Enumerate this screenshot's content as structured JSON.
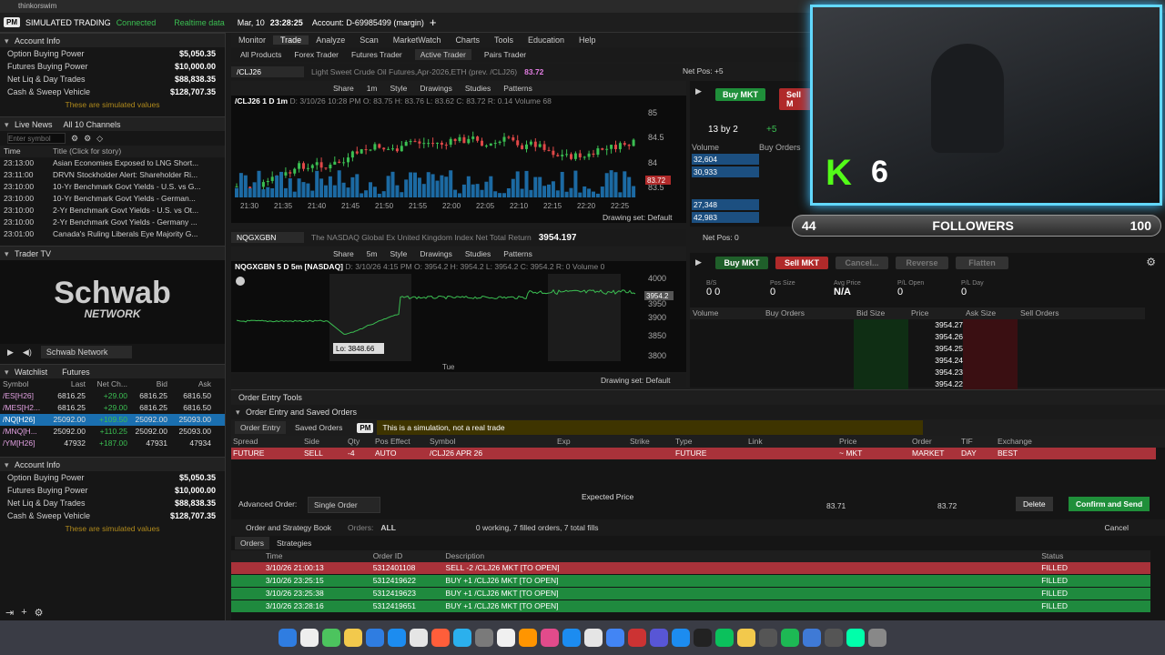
{
  "mac_app": "thinkorswim",
  "header": {
    "pm": "PM",
    "sim": "SIMULATED TRADING",
    "connected": "Connected",
    "realtime": "Realtime data",
    "date": "Mar, 10",
    "time": "23:28:25",
    "account": "Account: D-69985499 (margin)"
  },
  "left": {
    "account_title": "Account Info",
    "account": [
      [
        "Option Buying Power",
        "$5,050.35"
      ],
      [
        "Futures Buying Power",
        "$10,000.00"
      ],
      [
        "Net Liq & Day Trades",
        "$88,838.35"
      ],
      [
        "Cash & Sweep Vehicle",
        "$128,707.35"
      ]
    ],
    "sim_note": "These are simulated values",
    "news_title": "Live News",
    "news_channels": "All 10 Channels",
    "news_search": "Enter symbol",
    "news_cols": [
      "Time",
      "Title (Click for story)"
    ],
    "news": [
      [
        "23:13:00",
        "Asian Economies Exposed to LNG Short..."
      ],
      [
        "23:11:00",
        "DRVN Stockholder Alert: Shareholder Ri..."
      ],
      [
        "23:10:00",
        "10-Yr Benchmark Govt Yields - U.S. vs G..."
      ],
      [
        "23:10:00",
        "10-Yr Benchmark Govt Yields - German..."
      ],
      [
        "23:10:00",
        "2-Yr Benchmark Govt Yields - U.S. vs Ot..."
      ],
      [
        "23:10:00",
        "2-Yr Benchmark Govt Yields - Germany ..."
      ],
      [
        "23:01:00",
        "Canada's Ruling Liberals Eye Majority G..."
      ]
    ],
    "tv_title": "Trader TV",
    "tv_logo": "Schwab",
    "tv_logo_sub": "NETWORK",
    "tv_channel": "Schwab Network",
    "wl_title": "Watchlist",
    "wl_name": "Futures",
    "wl_cols": [
      "Symbol",
      "Last",
      "Net Ch...",
      "Bid",
      "Ask"
    ],
    "wl": [
      [
        "/ES[H26]",
        "6816.25",
        "+29.00",
        "6816.25",
        "6816.50"
      ],
      [
        "/MES[H2...",
        "6816.25",
        "+29.00",
        "6816.25",
        "6816.50"
      ],
      [
        "/NQ[H26]",
        "25092.00",
        "+109.50",
        "25092.00",
        "25093.00"
      ],
      [
        "/MNQ[H...",
        "25092.00",
        "+110.25",
        "25092.00",
        "25093.00"
      ],
      [
        "/YM[H26]",
        "47932",
        "+187.00",
        "47931",
        "47934"
      ]
    ],
    "account2_title": "Account Info"
  },
  "menu": [
    "Monitor",
    "Trade",
    "Analyze",
    "Scan",
    "MarketWatch",
    "Charts",
    "Tools",
    "Education",
    "Help"
  ],
  "submenu": [
    "All Products",
    "Forex Trader",
    "Futures Trader",
    "Active Trader",
    "Pairs Trader"
  ],
  "chart1": {
    "symbol": "/CLJ26",
    "desc": "Light Sweet Crude Oil Futures,Apr-2026,ETH (prev. /CLJ26)",
    "last": "83.72",
    "netpos": "Net Pos: +5",
    "title": "/CLJ26 1 D 1m",
    "ohlc": "D: 3/10/26 10:28 PM  O: 83.75  H: 83.76  L: 83.62  C: 83.72  R: 0.14  Volume 68",
    "tools": [
      "Share",
      "1m",
      "Style",
      "Drawings",
      "Studies",
      "Patterns"
    ],
    "yticks": [
      "85",
      "84.5",
      "84",
      "83.5"
    ],
    "price_tag": "83.72",
    "xticks": [
      "21:30",
      "21:35",
      "21:40",
      "21:45",
      "21:50",
      "21:55",
      "22:00",
      "22:05",
      "22:10",
      "22:15",
      "22:20",
      "22:25"
    ],
    "drawing": "Drawing set: Default",
    "buy": "Buy MKT",
    "sell": "Sell M",
    "bs": "13 by 2",
    "pos": "+5",
    "vol_cols": [
      "Volume",
      "Buy Orders"
    ],
    "vols": [
      "32,604",
      "30,933",
      "27,348",
      "42,983"
    ]
  },
  "chart2": {
    "symbol": "NQGXGBN",
    "desc": "The NASDAQ Global Ex United Kingdom Index Net Total Return",
    "last": "3954.197",
    "netpos": "Net Pos: 0",
    "title": "NQGXGBN 5 D 5m [NASDAQ]",
    "ohlc": "D: 3/10/26 4:15 PM  O: 3954.2  H: 3954.2  L: 3954.2  C: 3954.2  R: 0  Volume 0",
    "tools": [
      "Share",
      "5m",
      "Style",
      "Drawings",
      "Studies",
      "Patterns"
    ],
    "yticks": [
      "4000",
      "3950",
      "3900",
      "3850",
      "3800"
    ],
    "price_tag": "3954.2",
    "lo": "Lo: 3848.66",
    "xlabel": "Tue",
    "drawing": "Drawing set: Default"
  },
  "trade2": {
    "buttons": [
      "Buy MKT",
      "Sell MKT",
      "Cancel...",
      "Reverse",
      "Flatten"
    ],
    "stats_lbl": [
      "B/S",
      "Pos Size",
      "Avg Price",
      "P/L Open",
      "P/L Day"
    ],
    "stats": [
      "0  0",
      "0",
      "N/A",
      "0",
      "0"
    ],
    "cols": [
      "Volume",
      "Buy Orders",
      "Bid Size",
      "Price",
      "Ask Size",
      "Sell Orders"
    ],
    "prices": [
      "3954.27",
      "3954.26",
      "3954.25",
      "3954.24",
      "3954.23",
      "3954.22"
    ]
  },
  "oe": {
    "title": "Order Entry Tools",
    "sub": "Order Entry and Saved Orders",
    "tab1": "Order Entry",
    "tab2": "Saved Orders",
    "pm": "PM",
    "sim_msg": "This is a simulation, not a real trade",
    "cols": [
      "Spread",
      "Side",
      "Qty",
      "Pos Effect",
      "Symbol",
      "Exp",
      "Strike",
      "Type",
      "Link",
      "Price",
      "Order",
      "TIF",
      "Exchange"
    ],
    "row": [
      "FUTURE",
      "SELL",
      "-4",
      "AUTO",
      "/CLJ26  APR 26",
      "",
      "",
      "FUTURE",
      "",
      "~ MKT",
      "MARKET",
      "DAY",
      "BEST"
    ],
    "adv_label": "Advanced Order:",
    "adv_val": "Single Order",
    "expected": "Expected  Price",
    "nat": "83.71",
    "mid": "83.72",
    "delete": "Delete",
    "confirm": "Confirm and Send",
    "book_title": "Order and Strategy Book",
    "orders_lbl": "Orders:",
    "orders_val": "ALL",
    "summary": "0 working, 7 filled orders, 7 total fills",
    "cancel": "Cancel",
    "tabs": [
      "Orders",
      "Strategies"
    ],
    "ocols": [
      "Time",
      "Order ID",
      "Description",
      "Status"
    ],
    "orders": [
      [
        "3/10/26 21:00:13",
        "5312401108",
        "SELL -2 /CLJ26 MKT [TO OPEN]",
        "FILLED"
      ],
      [
        "3/10/26 23:25:15",
        "5312419622",
        "BUY +1 /CLJ26 MKT [TO OPEN]",
        "FILLED"
      ],
      [
        "3/10/26 23:25:38",
        "5312419623",
        "BUY +1 /CLJ26 MKT [TO OPEN]",
        "FILLED"
      ],
      [
        "3/10/26 23:28:16",
        "5312419651",
        "BUY +1 /CLJ26 MKT [TO OPEN]",
        "FILLED"
      ]
    ]
  },
  "overlay": {
    "k_count": "6",
    "followers_left": "44",
    "followers": "FOLLOWERS",
    "followers_right": "100"
  }
}
